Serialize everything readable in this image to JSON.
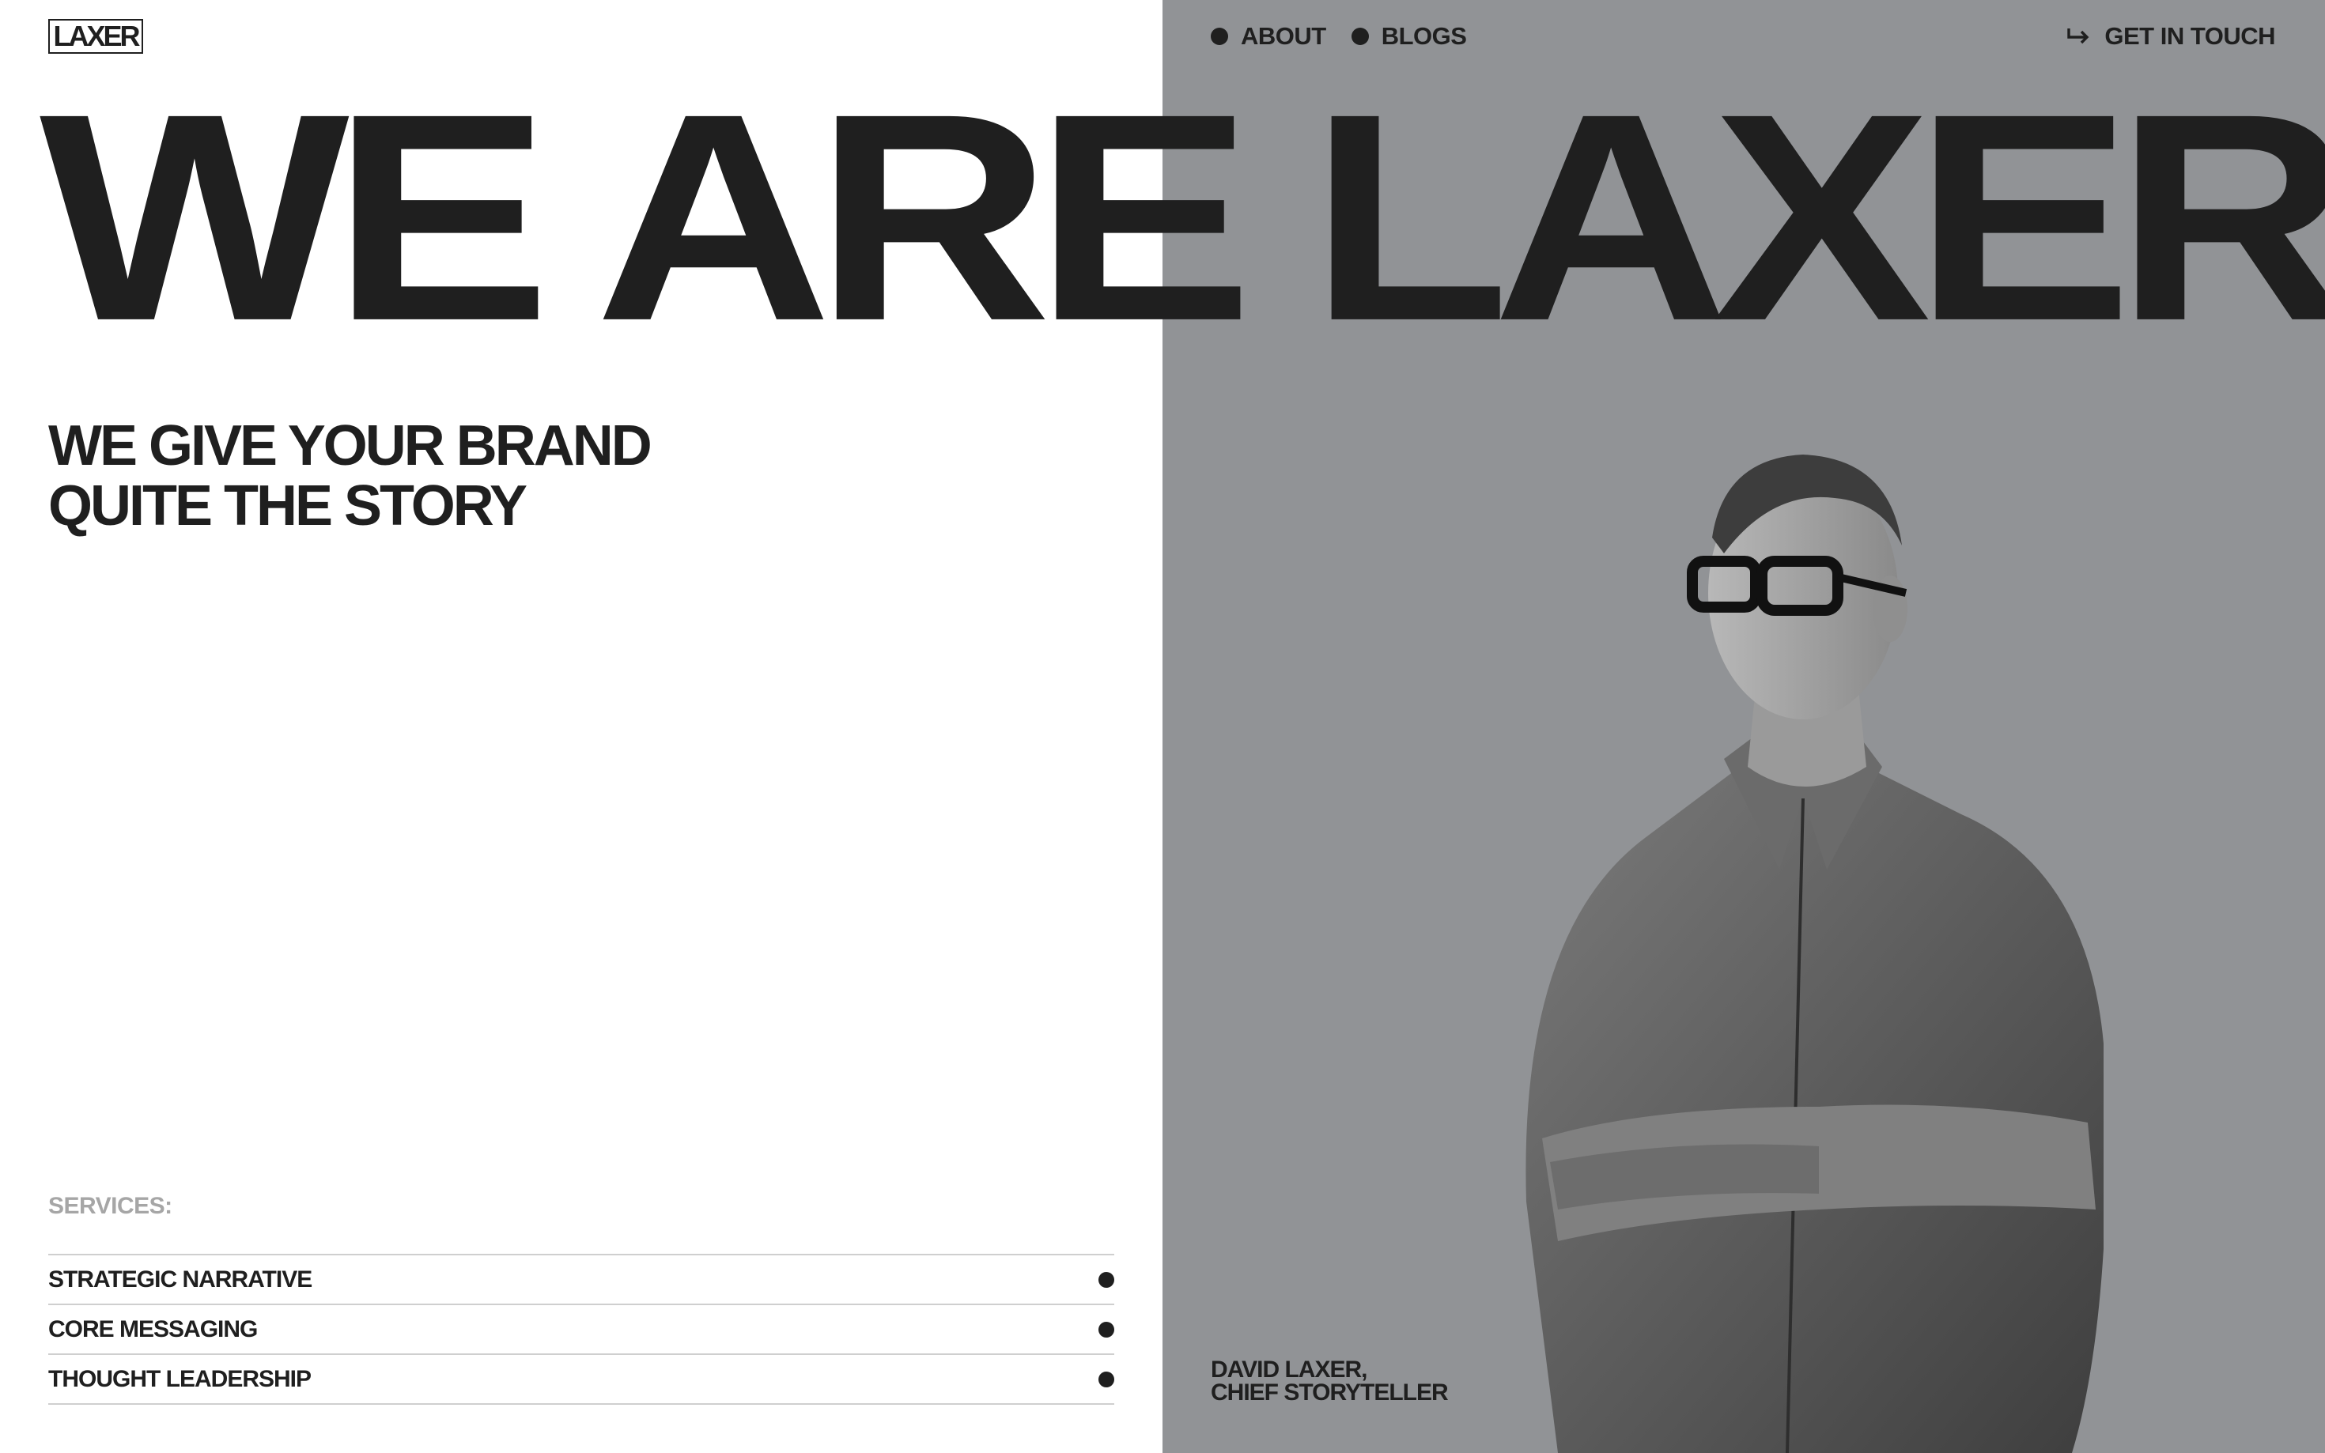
{
  "brand": {
    "logo_text": "LAXER"
  },
  "nav": {
    "about": "ABOUT",
    "blogs": "BLOGS",
    "contact": "GET IN TOUCH"
  },
  "hero": {
    "title": "WE ARE LAXER"
  },
  "tagline": {
    "line1": "WE GIVE YOUR BRAND",
    "line2": "QUITE THE STORY"
  },
  "services": {
    "label": "SERVICES:",
    "items": [
      {
        "name": "STRATEGIC NARRATIVE"
      },
      {
        "name": "CORE MESSAGING"
      },
      {
        "name": "THOUGHT LEADERSHIP"
      }
    ]
  },
  "portrait": {
    "name": "DAVID LAXER,",
    "role": "CHIEF STORYTELLER"
  },
  "icons": {
    "nav_bullet": "dot-icon",
    "contact": "arrow-return-right-icon",
    "service_bullet": "dot-icon"
  },
  "colors": {
    "text": "#1f1f1f",
    "right_panel": "#919396",
    "muted_label": "#a6a6a6",
    "divider": "#cfcfcf",
    "background": "#ffffff"
  }
}
